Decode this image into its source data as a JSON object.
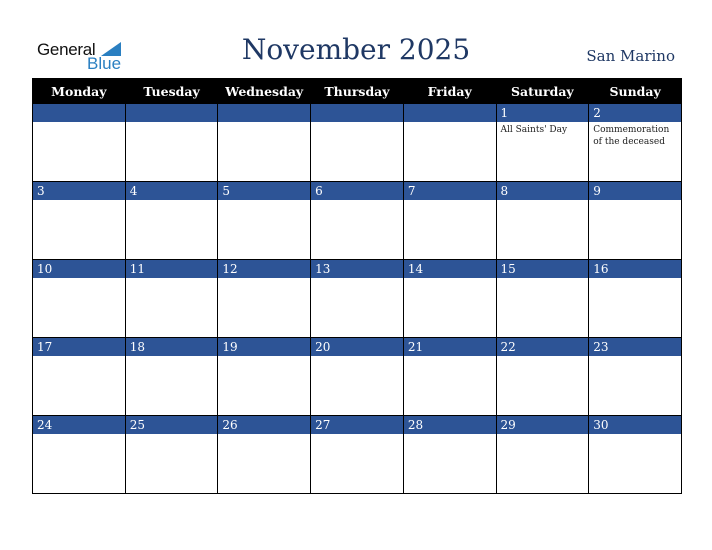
{
  "logo": {
    "line1": "General",
    "line2": "Blue"
  },
  "title": "November 2025",
  "country": "San Marino",
  "colors": {
    "header_bg": "#000000",
    "band_bg": "#2d5496",
    "title": "#1f3864",
    "logo_blue": "#2a7fc1"
  },
  "weekdays": [
    "Monday",
    "Tuesday",
    "Wednesday",
    "Thursday",
    "Friday",
    "Saturday",
    "Sunday"
  ],
  "weeks": [
    [
      {
        "day": ""
      },
      {
        "day": ""
      },
      {
        "day": ""
      },
      {
        "day": ""
      },
      {
        "day": ""
      },
      {
        "day": "1",
        "event": "All Saints' Day"
      },
      {
        "day": "2",
        "event": "Commemoration of the deceased"
      }
    ],
    [
      {
        "day": "3"
      },
      {
        "day": "4"
      },
      {
        "day": "5"
      },
      {
        "day": "6"
      },
      {
        "day": "7"
      },
      {
        "day": "8"
      },
      {
        "day": "9"
      }
    ],
    [
      {
        "day": "10"
      },
      {
        "day": "11"
      },
      {
        "day": "12"
      },
      {
        "day": "13"
      },
      {
        "day": "14"
      },
      {
        "day": "15"
      },
      {
        "day": "16"
      }
    ],
    [
      {
        "day": "17"
      },
      {
        "day": "18"
      },
      {
        "day": "19"
      },
      {
        "day": "20"
      },
      {
        "day": "21"
      },
      {
        "day": "22"
      },
      {
        "day": "23"
      }
    ],
    [
      {
        "day": "24"
      },
      {
        "day": "25"
      },
      {
        "day": "26"
      },
      {
        "day": "27"
      },
      {
        "day": "28"
      },
      {
        "day": "29"
      },
      {
        "day": "30"
      }
    ]
  ]
}
